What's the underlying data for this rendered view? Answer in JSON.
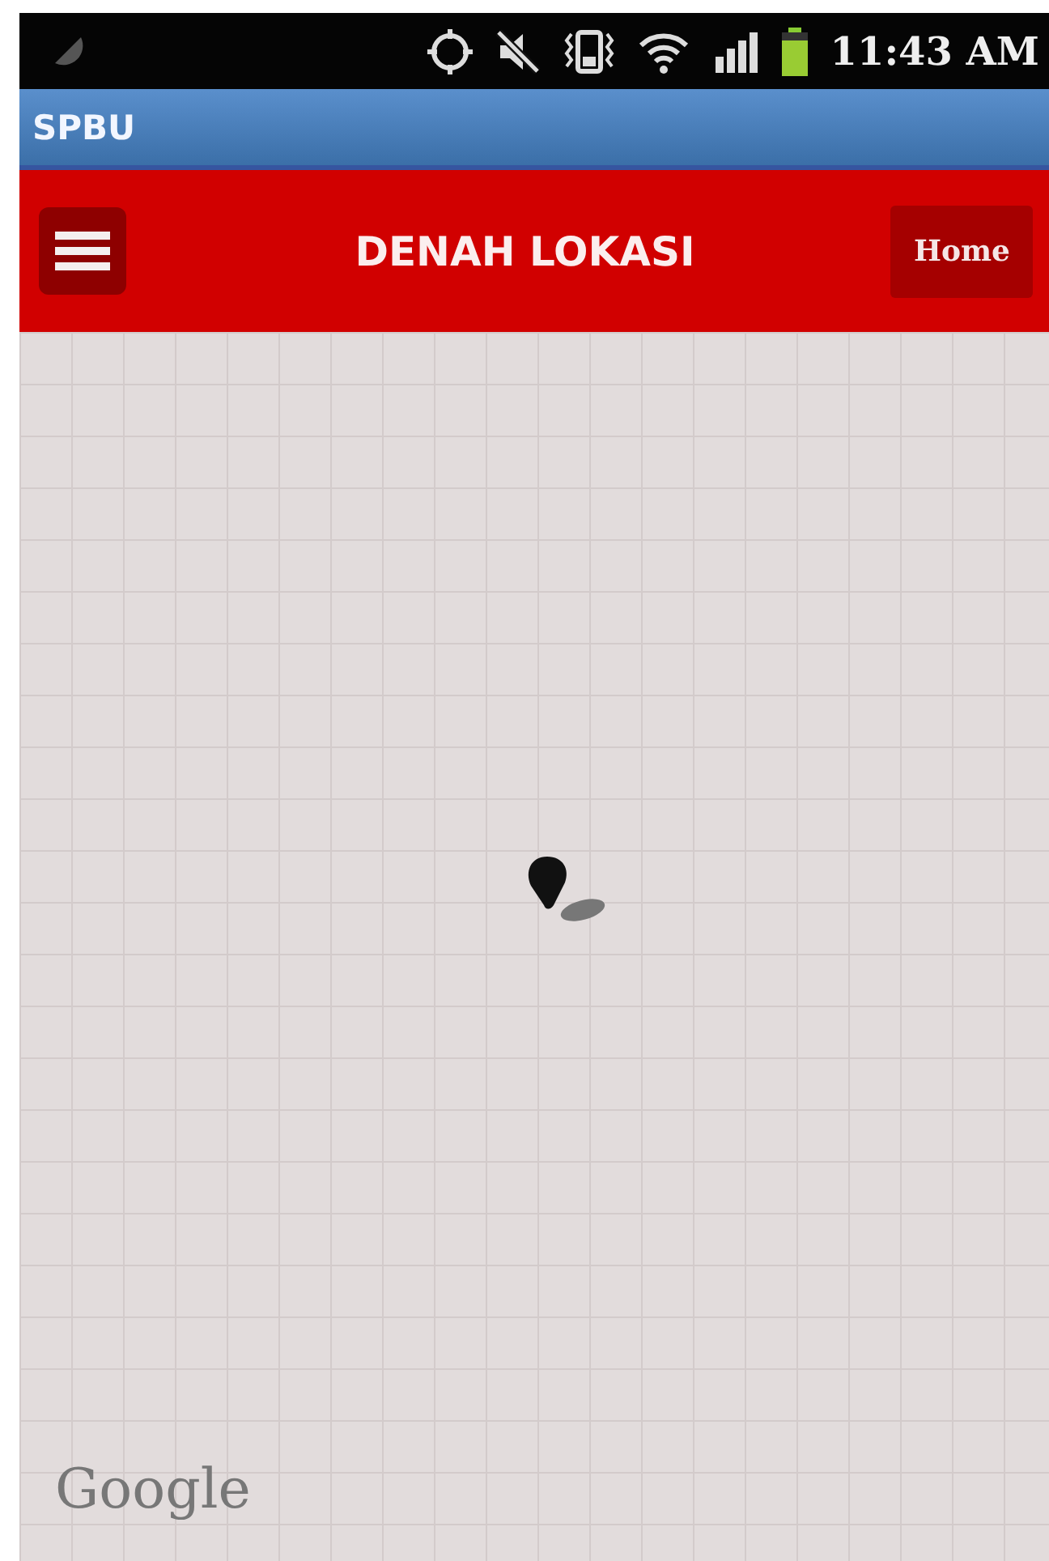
{
  "status_bar": {
    "time": "11:43 AM"
  },
  "app_bar": {
    "title": "SPBU"
  },
  "header": {
    "title": "DENAH LOKASI",
    "home_button": "Home"
  },
  "map": {
    "attribution": "Google"
  }
}
